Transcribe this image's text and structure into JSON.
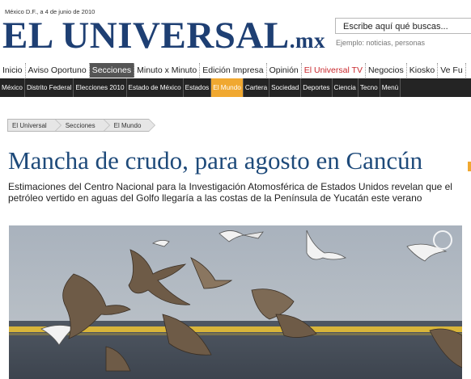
{
  "header": {
    "date": "México D.F., a 4 de junio de 2010",
    "logo_main": "EL UNIVERSAL",
    "logo_suffix": ".mx",
    "search_placeholder": "Escribe aquí qué buscas...",
    "search_hint": "Ejemplo: noticias, personas"
  },
  "nav_primary": [
    {
      "label": "Inicio"
    },
    {
      "label": "Aviso Oportuno"
    },
    {
      "label": "Secciones",
      "active": true
    },
    {
      "label": "Minuto x Minuto"
    },
    {
      "label": "Edición Impresa"
    },
    {
      "label": "Opinión"
    },
    {
      "label": "El Universal TV",
      "accent": true
    },
    {
      "label": "Negocios"
    },
    {
      "label": "Kiosko"
    },
    {
      "label": "Ve Fu"
    }
  ],
  "nav_secondary": [
    {
      "label": "México"
    },
    {
      "label": "Distrito Federal"
    },
    {
      "label": "Elecciones 2010"
    },
    {
      "label": "Estado de México"
    },
    {
      "label": "Estados"
    },
    {
      "label": "El Mundo",
      "active": true
    },
    {
      "label": "Cartera"
    },
    {
      "label": "Sociedad"
    },
    {
      "label": "Deportes"
    },
    {
      "label": "Ciencia"
    },
    {
      "label": "Tecno"
    },
    {
      "label": "Menú"
    }
  ],
  "breadcrumb": [
    "El Universal",
    "Secciones",
    "El Mundo"
  ],
  "article": {
    "headline": "Mancha de crudo, para agosto en Cancún",
    "summary": "Estimaciones del Centro Nacional para la Investigación Atomosférica de Estados Unidos revelan que el petróleo vertido en aguas del Golfo llegaría a las costas de la Península de Yucatán este verano"
  },
  "colors": {
    "brand_blue": "#1e3f73",
    "headline_blue": "#1e4a7a",
    "nav_dark": "#242424",
    "active_orange": "#f0a830",
    "accent_red": "#c8282d"
  }
}
